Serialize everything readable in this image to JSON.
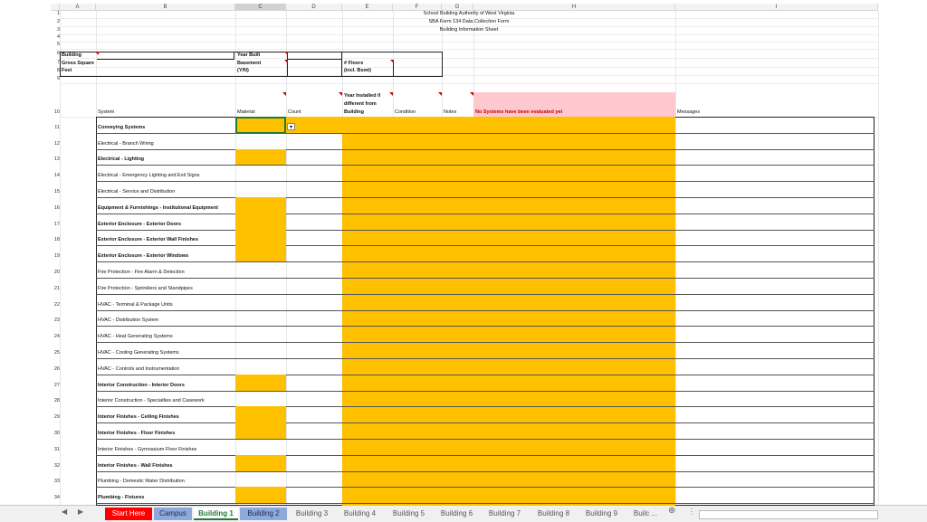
{
  "columns": [
    "A",
    "B",
    "C",
    "D",
    "E",
    "F",
    "G",
    "H",
    "I"
  ],
  "title_lines": [
    "School Building Authority of West Virginia",
    "SBA Form 134 Data Collection Form",
    "Building Information Sheet"
  ],
  "info": {
    "building": "Building",
    "gsf_1": "Gross Square",
    "gsf_2": "Feet",
    "year_built": "Year Built",
    "basement_1": "Basement",
    "basement_2": "(Y/N)",
    "floors_1": "# Floors",
    "floors_2": "(incl. Bsmt)"
  },
  "headers": {
    "system": "System",
    "material": "Material",
    "count": "Count",
    "year_1": "Year Installed if",
    "year_2": "different from",
    "year_3": "Building",
    "condition": "Condition",
    "notes": "Notes",
    "status": "No Systems have been evaluated yet",
    "messages": "Messages"
  },
  "row_numbers": [
    "1",
    "2",
    "3",
    "4",
    "5",
    "6",
    "7",
    "8",
    "9",
    "10"
  ],
  "systems": [
    {
      "row": "11",
      "label": "Conveying Systems",
      "bold": true,
      "material_orange": true
    },
    {
      "row": "12",
      "label": "Electrical - Branch Wiring",
      "bold": false,
      "material_orange": false
    },
    {
      "row": "13",
      "label": "Electrical - Lighting",
      "bold": true,
      "material_orange": true
    },
    {
      "row": "14",
      "label": "Electrical - Emergency Lighting and Exit Signs",
      "bold": false,
      "material_orange": false
    },
    {
      "row": "15",
      "label": "Electrical - Service and Distribution",
      "bold": false,
      "material_orange": false
    },
    {
      "row": "16",
      "label": "Equipment & Furnishings - Institutional Equipment",
      "bold": true,
      "material_orange": true
    },
    {
      "row": "17",
      "label": "Exterior Enclosure - Exterior Doors",
      "bold": true,
      "material_orange": true
    },
    {
      "row": "18",
      "label": "Exterior Enclosure - Exterior Wall Finishes",
      "bold": true,
      "material_orange": true
    },
    {
      "row": "19",
      "label": "Exterior Enclosure - Exterior Windows",
      "bold": true,
      "material_orange": true
    },
    {
      "row": "20",
      "label": "Fire Protection - Fire Alarm & Detection",
      "bold": false,
      "material_orange": false
    },
    {
      "row": "21",
      "label": "Fire Protection - Sprinklers and Standpipes",
      "bold": false,
      "material_orange": false
    },
    {
      "row": "22",
      "label": "HVAC - Terminal & Package Units",
      "bold": false,
      "material_orange": false
    },
    {
      "row": "23",
      "label": "HVAC - Distribution System",
      "bold": false,
      "material_orange": false
    },
    {
      "row": "24",
      "label": "HVAC - Heat Generating Systems",
      "bold": false,
      "material_orange": false
    },
    {
      "row": "25",
      "label": "HVAC - Cooling Generating Systems",
      "bold": false,
      "material_orange": false
    },
    {
      "row": "26",
      "label": "HVAC - Controls and Instrumentation",
      "bold": false,
      "material_orange": false
    },
    {
      "row": "27",
      "label": "Interior Construction - Interior Doors",
      "bold": true,
      "material_orange": true
    },
    {
      "row": "28",
      "label": "Interior Construction - Specialties and Casework",
      "bold": false,
      "material_orange": false
    },
    {
      "row": "29",
      "label": "Interior Finishes - Ceiling Finishes",
      "bold": true,
      "material_orange": true
    },
    {
      "row": "30",
      "label": "Interior Finishes - Floor Finishes",
      "bold": true,
      "material_orange": true
    },
    {
      "row": "31",
      "label": "Interior Finishes - Gymnasium Floor Finishes",
      "bold": false,
      "material_orange": false
    },
    {
      "row": "32",
      "label": "Interior Finishes - Wall Finishes",
      "bold": true,
      "material_orange": true
    },
    {
      "row": "33",
      "label": "Plumbing - Domestic Water Distribution",
      "bold": false,
      "material_orange": false
    },
    {
      "row": "34",
      "label": "Plumbing - Fixtures",
      "bold": true,
      "material_orange": true
    }
  ],
  "tabs": [
    {
      "label": "Start Here",
      "style": "red"
    },
    {
      "label": "Campus",
      "style": "blue"
    },
    {
      "label": "Building 1",
      "style": "active"
    },
    {
      "label": "Building 2",
      "style": "blue"
    },
    {
      "label": "Building 3",
      "style": "plain"
    },
    {
      "label": "Building 4",
      "style": "plain"
    },
    {
      "label": "Building 5",
      "style": "plain"
    },
    {
      "label": "Building 6",
      "style": "plain"
    },
    {
      "label": "Building 7",
      "style": "plain"
    },
    {
      "label": "Building 8",
      "style": "plain"
    },
    {
      "label": "Building 9",
      "style": "plain"
    },
    {
      "label": "Builc ...",
      "style": "plain"
    }
  ],
  "icons": {
    "add_sheet": "plus-circle-icon",
    "dropdown": "chevron-down-icon",
    "nav_prev": "triangle-left-icon",
    "nav_next": "triangle-right-icon"
  },
  "colors": {
    "orange": "#ffc000",
    "pink": "#ffc7ce",
    "red_tab": "#ff0000",
    "blue_tab": "#8ea9db",
    "active_tab_text": "#1e7b34"
  }
}
